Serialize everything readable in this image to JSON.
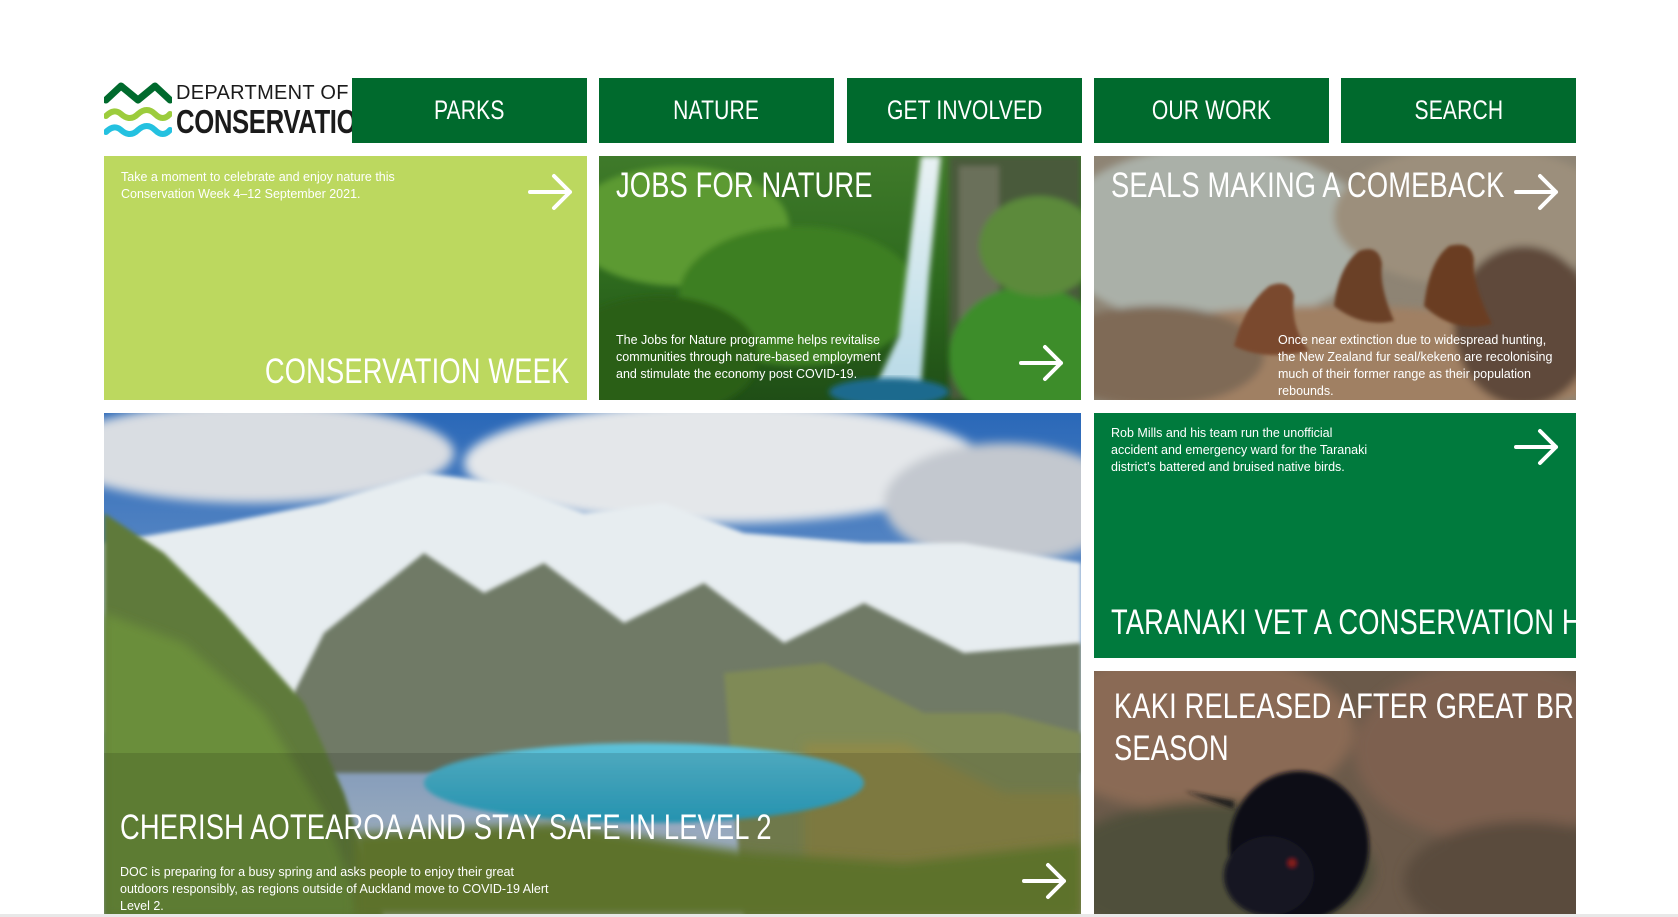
{
  "brand": {
    "line1": "DEPARTMENT OF",
    "line2": "CONSERVATION",
    "colors": {
      "wave_dark": "#006a2d",
      "wave_lime": "#9ccc3c",
      "wave_cyan": "#24c1e0"
    }
  },
  "nav": {
    "items": [
      {
        "label": "PARKS"
      },
      {
        "label": "NATURE"
      },
      {
        "label": "GET INVOLVED"
      },
      {
        "label": "OUR WORK"
      },
      {
        "label": "SEARCH"
      }
    ]
  },
  "tiles": {
    "conservation_week": {
      "title": "CONSERVATION WEEK",
      "description": "Take a moment to celebrate and enjoy nature this Conservation Week 4–12 September 2021."
    },
    "jobs_for_nature": {
      "title": "JOBS FOR NATURE",
      "description": "The Jobs for Nature programme helps revitalise communities through nature-based employment and stimulate the economy post COVID-19."
    },
    "seals": {
      "title": "SEALS MAKING A COMEBACK",
      "description": "Once near extinction due to widespread hunting, the New Zealand fur seal/kekeno are recolonising much of their former range as their population rebounds."
    },
    "level2": {
      "title": "CHERISH AOTEAROA AND STAY SAFE IN LEVEL 2",
      "description": "DOC is preparing for a busy spring and asks people to enjoy their great outdoors responsibly, as regions outside of Auckland move to COVID-19 Alert Level 2."
    },
    "taranaki": {
      "title": "TARANAKI VET A CONSERVATION HERO",
      "description": "Rob Mills and his team run the unofficial accident and emergency ward for the Taranaki district's battered and bruised native birds."
    },
    "kaki": {
      "title_line1": "KAKI RELEASED AFTER GREAT BREEDING",
      "title_line2": "SEASON"
    }
  },
  "colors": {
    "nav_green": "#006a2d",
    "lime": "#bcd85f",
    "taranaki_green": "#007a3d"
  },
  "icons": {
    "arrow": "arrow-right-icon"
  }
}
